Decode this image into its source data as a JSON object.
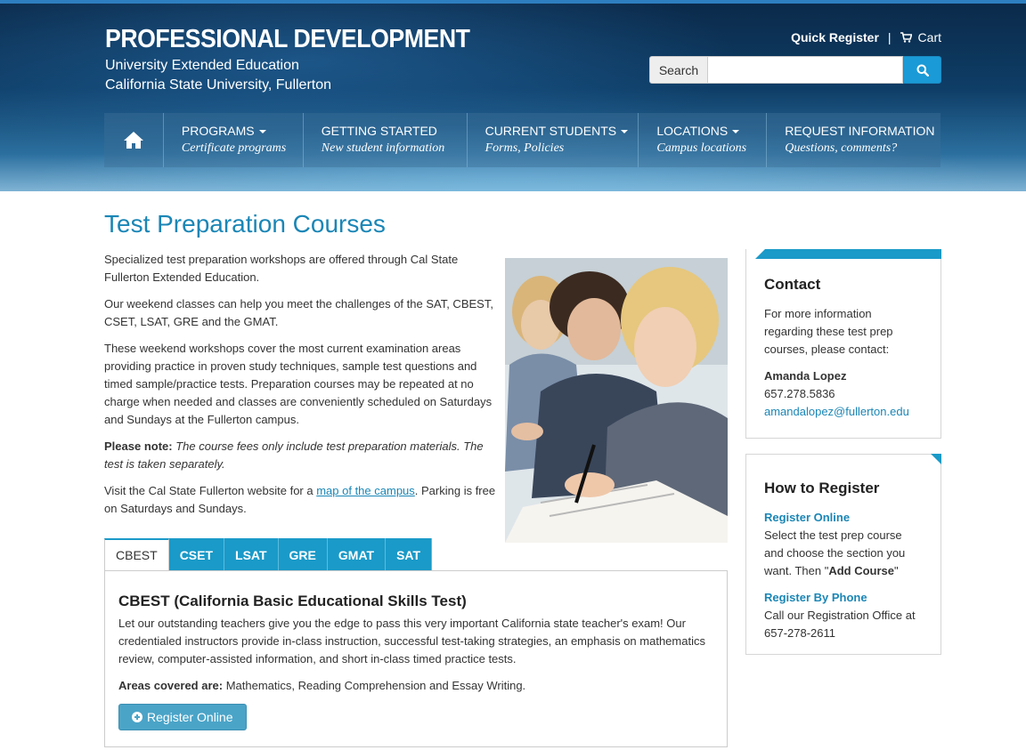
{
  "header": {
    "title": "PROFESSIONAL DEVELOPMENT",
    "subtitle_1": "University Extended Education",
    "subtitle_2": "California State University, Fullerton",
    "quick_register": "Quick Register",
    "separator": "|",
    "cart": "Cart",
    "search_label": "Search",
    "search_value": "",
    "search_placeholder": ""
  },
  "nav": {
    "home_icon": "home-icon",
    "items": [
      {
        "label": "PROGRAMS",
        "sub": "Certificate programs",
        "dropdown": true
      },
      {
        "label": "GETTING STARTED",
        "sub": "New student information",
        "dropdown": false
      },
      {
        "label": "CURRENT STUDENTS",
        "sub": "Forms, Policies",
        "dropdown": true
      },
      {
        "label": "LOCATIONS",
        "sub": "Campus locations",
        "dropdown": true
      },
      {
        "label": "REQUEST INFORMATION",
        "sub": "Questions, comments?",
        "dropdown": false
      }
    ]
  },
  "main": {
    "title": "Test Preparation Courses",
    "p1": "Specialized test preparation workshops are offered through Cal State Fullerton Extended Education.",
    "p2": "Our weekend classes can help you meet the challenges of the SAT, CBEST, CSET, LSAT, GRE and the GMAT.",
    "p3": "These weekend workshops cover the most current examination areas providing practice in proven study techniques, sample test questions and timed sample/practice tests. Preparation courses may be repeated at no charge when needed and classes are conveniently scheduled on Saturdays and Sundays at the Fullerton campus.",
    "note_label": "Please note:",
    "note_text": "The course fees only include test preparation materials. The test is taken separately.",
    "visit_before": "Visit the Cal State Fullerton website for a ",
    "visit_link": "map of the campus",
    "visit_after": ". Parking is free on Saturdays and Sundays."
  },
  "tabs": {
    "items": [
      "CBEST",
      "CSET",
      "LSAT",
      "GRE",
      "GMAT",
      "SAT"
    ],
    "active": "CBEST",
    "panel": {
      "heading": "CBEST (California Basic Educational Skills Test)",
      "body": "Let our outstanding teachers give you the edge to pass this very important California state teacher's exam! Our credentialed instructors provide in-class instruction, successful test-taking strategies, an emphasis on mathematics review, computer-assisted information, and short in-class timed practice tests.",
      "areas_label": "Areas covered are:",
      "areas_text": " Mathematics, Reading Comprehension and Essay Writing.",
      "button": "Register Online"
    }
  },
  "sidebar": {
    "contact": {
      "title": "Contact",
      "text": "For more information regarding these test prep courses, please contact:",
      "name": "Amanda Lopez",
      "phone": "657.278.5836",
      "email": "amandalopez@fullerton.edu"
    },
    "register": {
      "title": "How to Register",
      "online_head": "Register Online",
      "online_text_1": "Select the test prep course and choose the section you want. Then \"",
      "online_bold": "Add Course",
      "online_text_2": "\"",
      "phone_head": "Register By Phone",
      "phone_text": "Call our Registration Office at 657-278-2611"
    }
  },
  "colors": {
    "accent": "#1a9ac8",
    "link": "#1a86b6",
    "header_dark": "#0e3d66"
  }
}
